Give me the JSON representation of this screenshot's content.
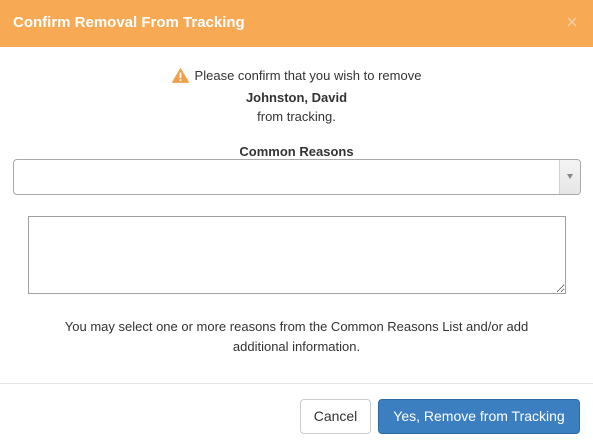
{
  "dialog": {
    "title": "Confirm Removal From Tracking",
    "close_glyph": "×"
  },
  "confirmation": {
    "line1": "Please confirm that you wish to remove",
    "person_name": "Johnston, David",
    "line3": "from tracking."
  },
  "reasons": {
    "label": "Common Reasons",
    "selected_value": ""
  },
  "notes": {
    "value": ""
  },
  "help_text": "You may select one or more reasons from the Common Reasons List and/or add additional information.",
  "footer": {
    "cancel_label": "Cancel",
    "confirm_label": "Yes, Remove from Tracking"
  },
  "colors": {
    "header_bg": "#f7a954",
    "primary_button": "#3c7fc0",
    "warning_icon": "#f0a04b"
  },
  "icons": {
    "warning": "warning-triangle-icon",
    "close": "close-icon",
    "dropdown": "chevron-down-icon"
  }
}
